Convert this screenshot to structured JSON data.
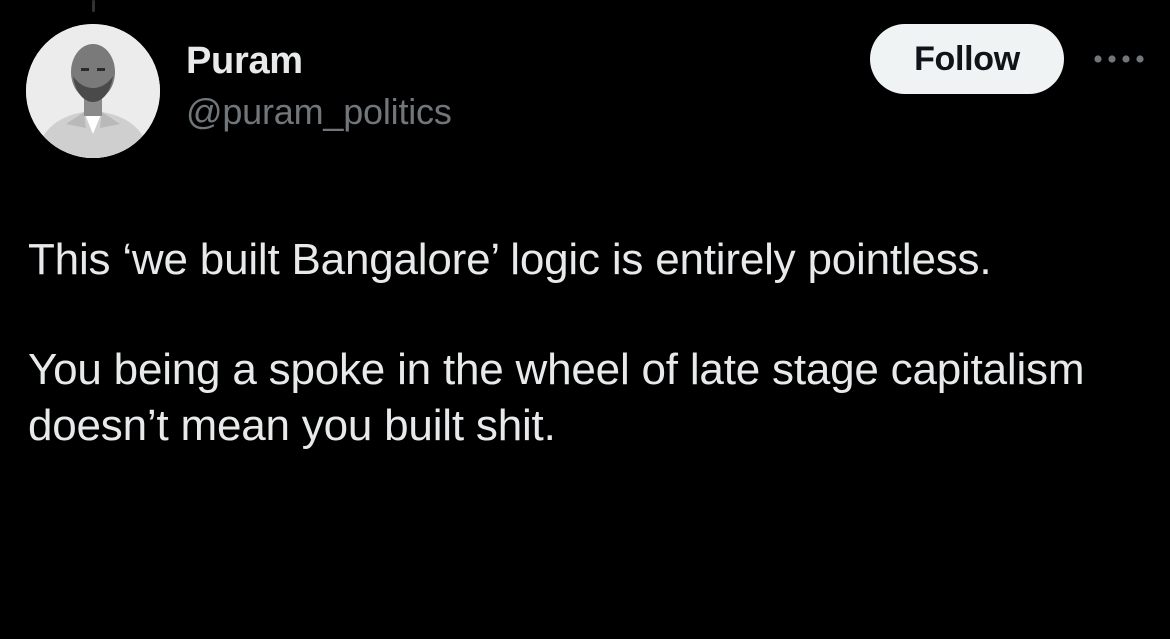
{
  "author": {
    "display_name": "Puram",
    "handle": "@puram_politics"
  },
  "actions": {
    "follow_label": "Follow",
    "more_icon": "more-horizontal-icon"
  },
  "tweet": {
    "paragraphs": [
      "This ‘we built Bangalore’ logic is entirely pointless.",
      "You being a spoke in the wheel of late stage capitalism doesn’t mean you built shit."
    ]
  },
  "colors": {
    "background": "#000000",
    "text_primary": "#e7e9ea",
    "text_secondary": "#71767b",
    "follow_bg": "#eff3f4",
    "follow_text": "#0f1419"
  }
}
